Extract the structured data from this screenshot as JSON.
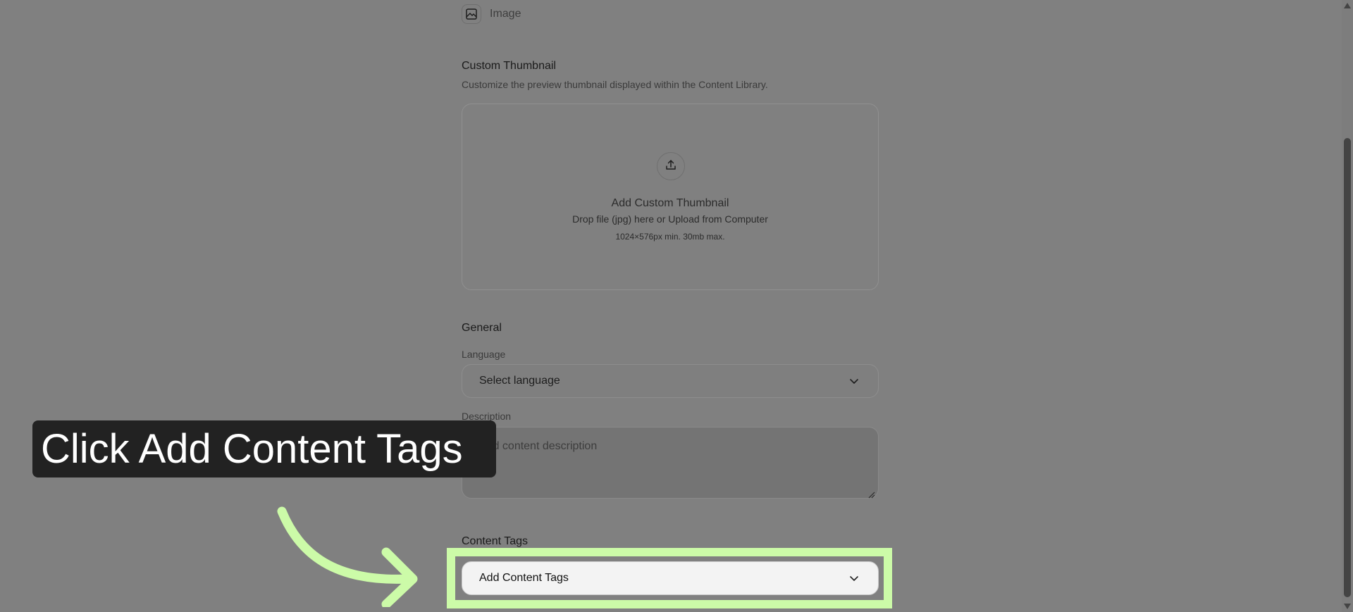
{
  "media_type": {
    "label": "Image",
    "icon": "image-icon"
  },
  "custom_thumbnail": {
    "title": "Custom Thumbnail",
    "subtitle": "Customize the preview thumbnail displayed within the Content Library.",
    "dropzone": {
      "icon": "upload-icon",
      "title": "Add Custom Thumbnail",
      "description": "Drop file (jpg) here or Upload from Computer",
      "limits": "1024×576px min. 30mb max."
    }
  },
  "general": {
    "title": "General",
    "language_label": "Language",
    "language_value": "Select language",
    "description_label": "Description",
    "description_placeholder": "Add content description"
  },
  "content_tags": {
    "title": "Content Tags",
    "select_value": "Add Content Tags"
  },
  "callout": {
    "text": "Click Add Content Tags"
  },
  "colors": {
    "overlay": "#808080",
    "highlight": "#ccfba8",
    "callout_bg": "#222222"
  }
}
